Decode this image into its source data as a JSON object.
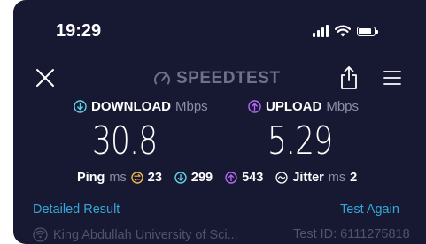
{
  "status_bar": {
    "time": "19:29"
  },
  "header": {
    "title": "SPEEDTEST",
    "close_icon": "close-icon",
    "share_icon": "share-icon",
    "menu_icon": "hamburger-menu-icon"
  },
  "download": {
    "label": "DOWNLOAD",
    "unit": "Mbps",
    "value": "30.8",
    "color": "#5fd4e6"
  },
  "upload": {
    "label": "UPLOAD",
    "unit": "Mbps",
    "value": "5.29",
    "color": "#b76af5"
  },
  "ping": {
    "label": "Ping",
    "unit": "ms",
    "idle": "23",
    "download": "299",
    "upload": "543",
    "idle_color": "#f2b84b"
  },
  "jitter": {
    "label": "Jitter",
    "unit": "ms",
    "value": "2"
  },
  "links": {
    "detailed": "Detailed Result",
    "again": "Test Again",
    "color": "#35a7d7"
  },
  "server": {
    "name": "King Abdullah University of Sci...",
    "test_id": "Test ID: 6111275818"
  }
}
